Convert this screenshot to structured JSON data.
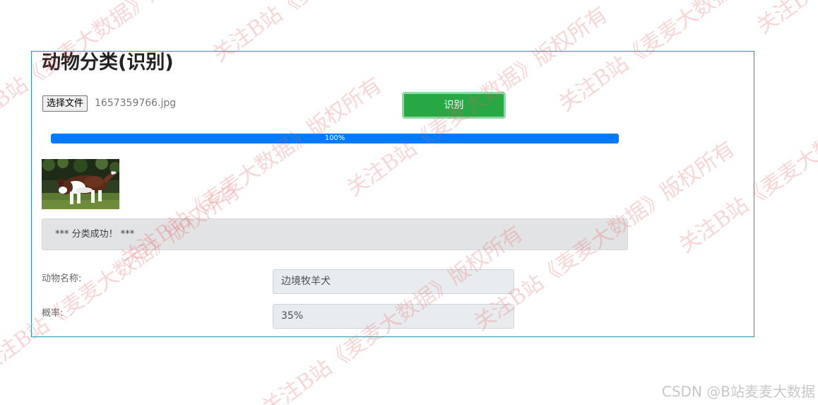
{
  "page": {
    "title": "动物分类(识别)"
  },
  "upload": {
    "choose_file_label": "选择文件",
    "file_name": "1657359766.jpg"
  },
  "recognize_button": {
    "label": "识别",
    "color": "#28a745"
  },
  "progress": {
    "percent": 100,
    "label": "100%",
    "color": "#007bff"
  },
  "result": {
    "status_message": "*** 分类成功！ ***",
    "name_label": "动物名称:",
    "name_value": "边境牧羊犬",
    "probability_label": "概率:",
    "probability_value": "35%"
  },
  "watermark": {
    "text": "关注B站《麦麦大数据》版权所有",
    "color": "#e85f5f"
  },
  "credit": "CSDN @B站麦麦大数据"
}
